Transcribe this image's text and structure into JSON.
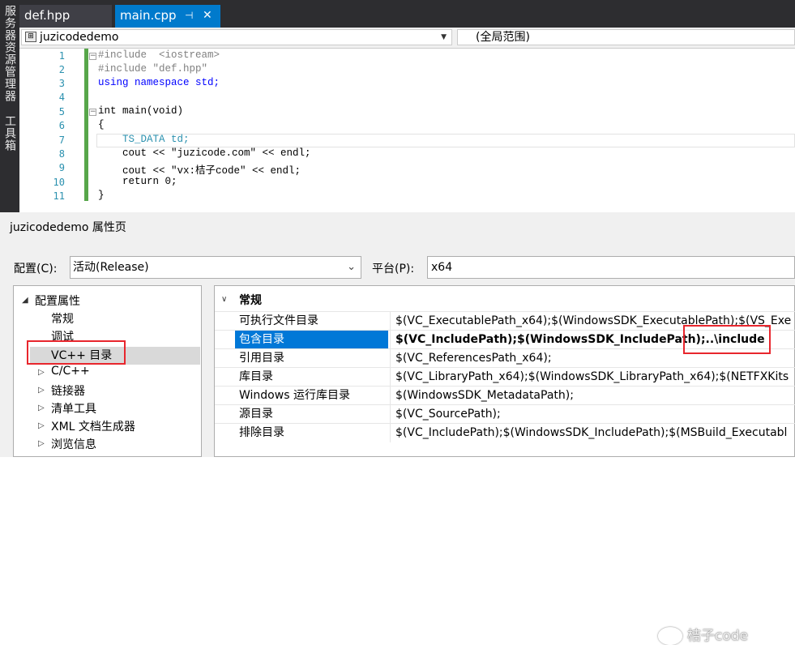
{
  "side_panel": {
    "solution_explorer": "服务器资源管理器",
    "toolbox": "工具箱"
  },
  "editor_tabs": [
    {
      "label": "def.hpp"
    },
    {
      "label": "main.cpp",
      "pin": "⊣",
      "close": "✕"
    }
  ],
  "navbar": {
    "scope": "juzicodedemo",
    "global_scope": "(全局范围)"
  },
  "code": {
    "line_numbers": [
      "1",
      "2",
      "3",
      "4",
      "5",
      "6",
      "7",
      "8",
      "9",
      "10",
      "11"
    ],
    "lines": [
      "#include  <iostream>",
      "#include \"def.hpp\"",
      "using namespace std;",
      "",
      "int main(void)",
      "{",
      "    TS_DATA td;",
      "    cout << \"juzicode.com\" << endl;",
      "    cout << \"vx:桔子code\" << endl;",
      "    return 0;",
      "}"
    ]
  },
  "dialog": {
    "title": "juzicodedemo 属性页",
    "config_label": "配置(C):",
    "config_value": "活动(Release)",
    "platform_label": "平台(P):",
    "platform_value": "x64",
    "tree": [
      {
        "label": "配置属性",
        "expanded": true
      },
      {
        "label": "常规"
      },
      {
        "label": "调试"
      },
      {
        "label": "VC++ 目录",
        "selected": true
      },
      {
        "label": "C/C++"
      },
      {
        "label": "链接器"
      },
      {
        "label": "清单工具"
      },
      {
        "label": "XML 文档生成器"
      },
      {
        "label": "浏览信息"
      }
    ],
    "section": "常规",
    "properties": [
      {
        "name": "可执行文件目录",
        "value": "$(VC_ExecutablePath_x64);$(WindowsSDK_ExecutablePath);$(VS_Exe"
      },
      {
        "name": "包含目录",
        "value": "$(VC_IncludePath);$(WindowsSDK_IncludePath);..\\include",
        "selected": true
      },
      {
        "name": "引用目录",
        "value": "$(VC_ReferencesPath_x64);"
      },
      {
        "name": "库目录",
        "value": "$(VC_LibraryPath_x64);$(WindowsSDK_LibraryPath_x64);$(NETFXKits"
      },
      {
        "name": "Windows 运行库目录",
        "value": "$(WindowsSDK_MetadataPath);"
      },
      {
        "name": "源目录",
        "value": "$(VC_SourcePath);"
      },
      {
        "name": "排除目录",
        "value": "$(VC_IncludePath);$(WindowsSDK_IncludePath);$(MSBuild_Executabl"
      }
    ]
  },
  "watermark": "桔子code",
  "colors": {
    "accent": "#007acc",
    "selection": "#0078d7",
    "highlight_box": "#e8262d",
    "change_bar": "#57a64a"
  }
}
